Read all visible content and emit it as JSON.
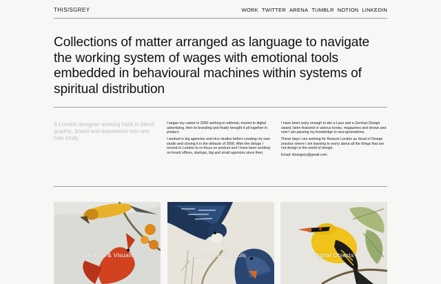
{
  "header": {
    "brand": "THISISGREY",
    "nav": [
      "WORK",
      "TWITTER",
      "ARENA",
      "TUMBLR",
      "NOTION",
      "LINKEDIN"
    ]
  },
  "hero": {
    "headline": "Collections of matter arranged as language to navigate the working system of wages with emotional tools embedded in behavioural machines within systems of spiritual distribution"
  },
  "intro": {
    "lead": "A London designer working hard to blend graphic, brand and experience into one holy trinity.",
    "column1": [
      "I began my career in 2000 working in editorial, moved to digital advertising, then to branding and finally brought it all together in product.",
      "I worked in big agencies and nice studios before creating my own studio and closing it in the debacle of 2008. After the deluge I moved to London to re-focus on product and I have been working on brand offices, startups, big and small agencies since then."
    ],
    "column2": [
      "I have been lucky enough to win a Laus and a German Design award, been featured in various books, magazines and shows and now I am passing my knowledge to new generations.",
      "These days I am working for Reason London as Head of Design practice where I am learning to worry about all the things that are not design in the world of design.",
      "Email: thisisgrey@gmail.com"
    ]
  },
  "gallery": [
    {
      "label": "Graphics & Visuals"
    },
    {
      "label": "Brands & Symbols"
    },
    {
      "label": "Digital Objects"
    }
  ],
  "colors": {
    "background": "#f7f7f5",
    "text": "#111111",
    "lead_grey": "#bdbdbd",
    "rule": "#9a9a9a"
  }
}
